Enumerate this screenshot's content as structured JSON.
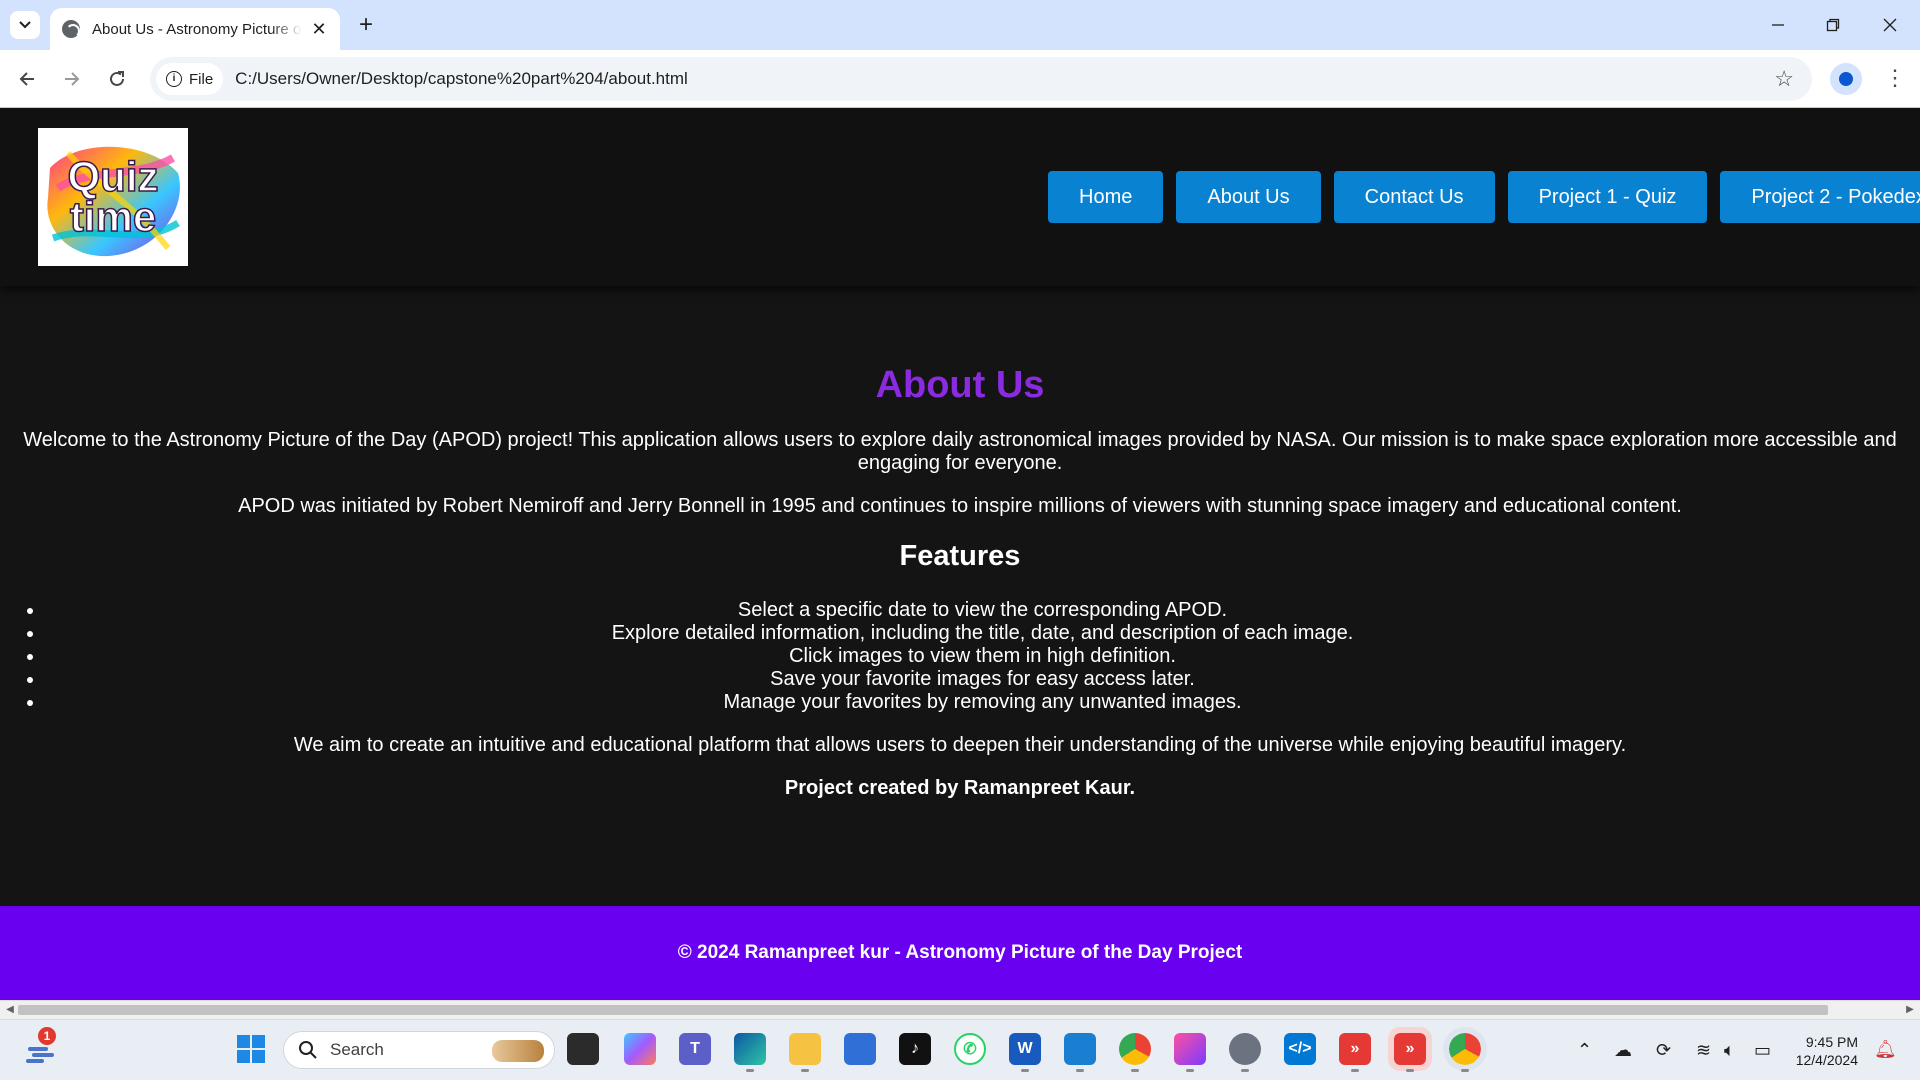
{
  "browser": {
    "tab_title": "About Us - Astronomy Picture of the Day",
    "tab_close": "✕",
    "new_tab": "+",
    "chip_label": "File",
    "url": "C:/Users/Owner/Desktop/capstone%20part%204/about.html"
  },
  "site": {
    "logo_text_line1": "Quiz",
    "logo_text_line2": "time",
    "nav": [
      {
        "label": "Home"
      },
      {
        "label": "About Us"
      },
      {
        "label": "Contact Us"
      },
      {
        "label": "Project 1 - Quiz"
      },
      {
        "label": "Project 2 - Pokedex"
      }
    ]
  },
  "content": {
    "heading": "About Us",
    "intro": "Welcome to the Astronomy Picture of the Day (APOD) project! This application allows users to explore daily astronomical images provided by NASA. Our mission is to make space exploration more accessible and engaging for everyone.",
    "history": "APOD was initiated by Robert Nemiroff and Jerry Bonnell in 1995 and continues to inspire millions of viewers with stunning space imagery and educational content.",
    "features_heading": "Features",
    "features": [
      "Select a specific date to view the corresponding APOD.",
      "Explore detailed information, including the title, date, and description of each image.",
      "Click images to view them in high definition.",
      "Save your favorite images for easy access later.",
      "Manage your favorites by removing any unwanted images."
    ],
    "aim": "We aim to create an intuitive and educational platform that allows users to deepen their understanding of the universe while enjoying beautiful imagery.",
    "credit": "Project created by Ramanpreet Kaur."
  },
  "footer": {
    "text": "© 2024 Ramanpreet kur - Astronomy Picture of the Day Project"
  },
  "taskbar": {
    "search_placeholder": "Search",
    "notification_count": "1",
    "time": "9:45 PM",
    "date": "12/4/2024"
  },
  "colors": {
    "accent_purple": "#8a2be2",
    "nav_blue": "#0a82d2",
    "footer_purple": "#6a00f0",
    "page_bg": "#141414"
  }
}
